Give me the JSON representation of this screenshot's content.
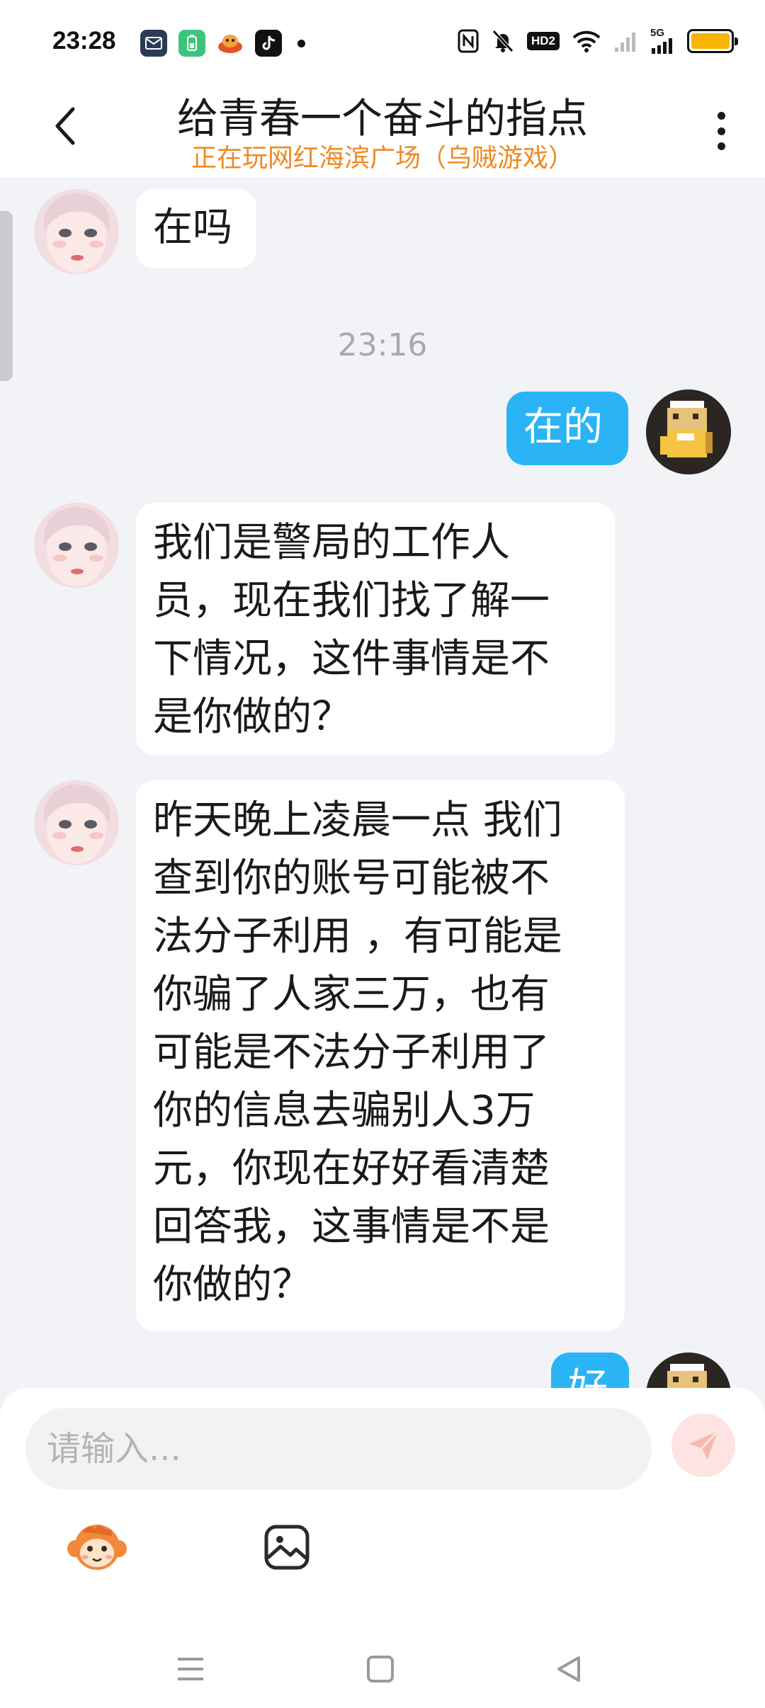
{
  "status_bar": {
    "time": "23:28",
    "network_badge": "HD2",
    "signal_label": "5G",
    "battery_color": "#f6b500",
    "icons": [
      "nfc-icon",
      "mute-bell-icon",
      "wifi-icon",
      "signal-icon",
      "battery-icon"
    ]
  },
  "header": {
    "title": "给青春一个奋斗的指点",
    "subtitle": "正在玩网红海滨广场（乌贼游戏）",
    "subtitle_color": "#ef8a24"
  },
  "messages": [
    {
      "side": "left",
      "text": "在吗"
    },
    {
      "type": "timestamp",
      "text": "23:16"
    },
    {
      "side": "right",
      "text": "在的"
    },
    {
      "side": "left",
      "lines": [
        "我们是警局的工作人",
        "员，现在我们找了解一",
        "下情况，这件事情是不",
        "是你做的？"
      ]
    },
    {
      "side": "left",
      "lines": [
        "昨天晚上凌晨一点 我们",
        "查到你的账号可能被不",
        "法分子利用 ，有可能是",
        "你骗了人家三万，也有",
        "可能是不法分子利用了",
        "你的信息去骗别人3万",
        "元，你现在好好看清楚",
        "回答我，这事情是不是",
        "你做的？"
      ]
    },
    {
      "side": "right",
      "text": "好"
    }
  ],
  "composer": {
    "placeholder": "请输入..."
  },
  "colors": {
    "my_bubble": "#2ab4f5",
    "their_bubble": "#ffffff",
    "background": "#f1f3f7"
  }
}
